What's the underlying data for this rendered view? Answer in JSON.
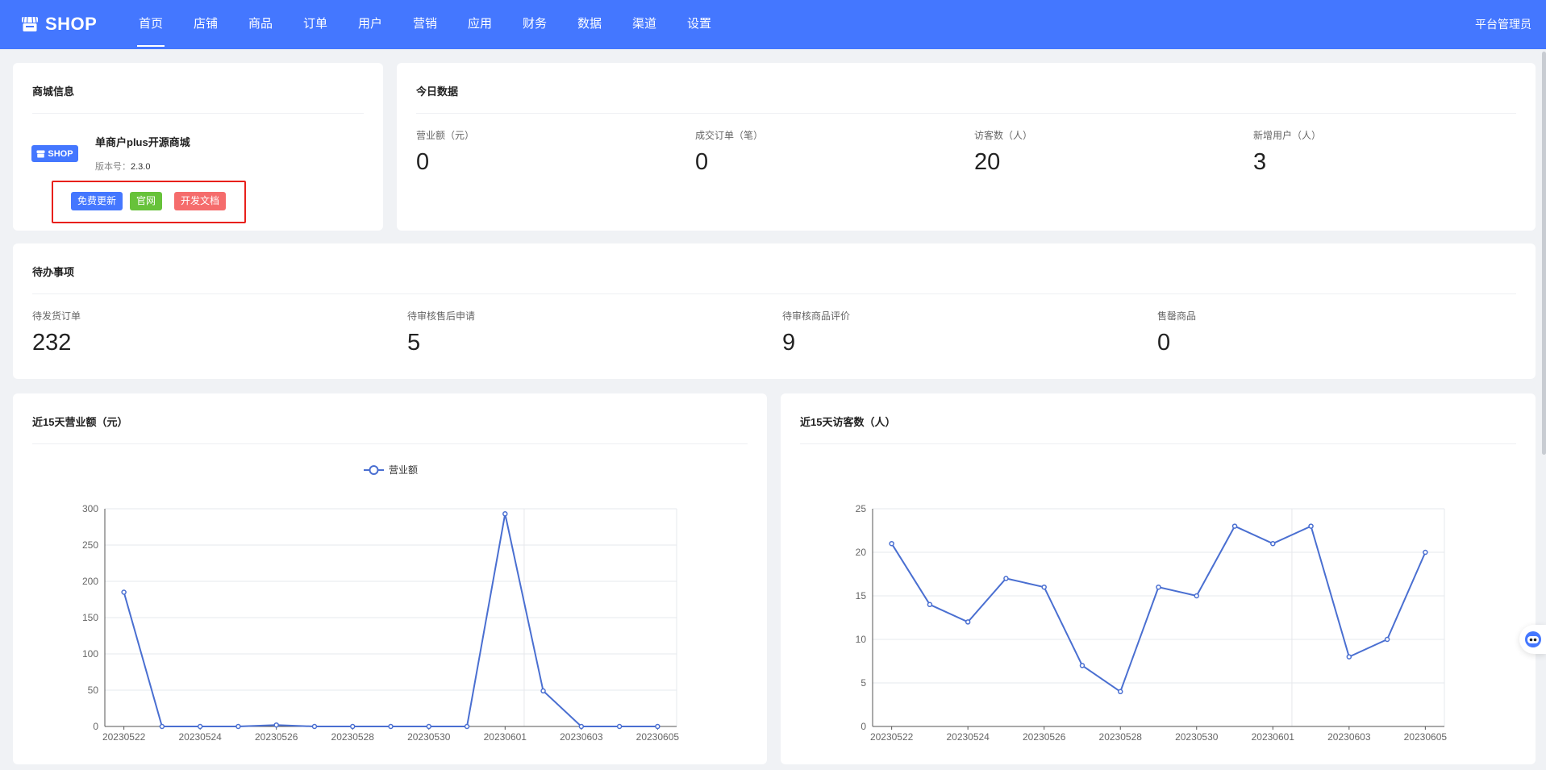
{
  "header": {
    "logo_text": "SHOP",
    "logo_icon": "store-icon",
    "nav": [
      {
        "label": "首页",
        "active": true
      },
      {
        "label": "店铺"
      },
      {
        "label": "商品"
      },
      {
        "label": "订单"
      },
      {
        "label": "用户"
      },
      {
        "label": "营销"
      },
      {
        "label": "应用"
      },
      {
        "label": "财务"
      },
      {
        "label": "数据"
      },
      {
        "label": "渠道"
      },
      {
        "label": "设置"
      }
    ],
    "user_role": "平台管理员"
  },
  "shop_info": {
    "title": "商城信息",
    "badge_text": "SHOP",
    "name": "单商户plus开源商城",
    "version_label": "版本号：",
    "version": "2.3.0",
    "buttons": {
      "update": "免费更新",
      "website": "官网",
      "docs": "开发文档"
    }
  },
  "today": {
    "title": "今日数据",
    "stats": [
      {
        "label": "营业额（元）",
        "value": "0"
      },
      {
        "label": "成交订单（笔）",
        "value": "0"
      },
      {
        "label": "访客数（人）",
        "value": "20"
      },
      {
        "label": "新增用户（人）",
        "value": "3"
      }
    ]
  },
  "todo": {
    "title": "待办事项",
    "items": [
      {
        "label": "待发货订单",
        "value": "232"
      },
      {
        "label": "待审核售后申请",
        "value": "5"
      },
      {
        "label": "待审核商品评价",
        "value": "9"
      },
      {
        "label": "售罄商品",
        "value": "0"
      }
    ]
  },
  "chart_data": [
    {
      "type": "line",
      "title": "近15天营业额（元）",
      "legend": "营业额",
      "legend_position": "top-center",
      "x": [
        "20230522",
        "20230523",
        "20230524",
        "20230525",
        "20230526",
        "20230527",
        "20230528",
        "20230529",
        "20230530",
        "20230531",
        "20230601",
        "20230602",
        "20230603",
        "20230604",
        "20230605"
      ],
      "x_tick_labels": [
        "20230522",
        "20230524",
        "20230526",
        "20230528",
        "20230530",
        "20230601",
        "20230603",
        "20230605"
      ],
      "series": [
        {
          "name": "营业额",
          "values": [
            185,
            0,
            0,
            0,
            2,
            0,
            0,
            0,
            0,
            0,
            293,
            49,
            0,
            0,
            0
          ]
        }
      ],
      "ylim": [
        0,
        300
      ],
      "y_ticks": [
        0,
        50,
        100,
        150,
        200,
        250,
        300
      ],
      "grid": true,
      "color": "#4a6fd1"
    },
    {
      "type": "line",
      "title": "近15天访客数（人）",
      "x": [
        "20230522",
        "20230523",
        "20230524",
        "20230525",
        "20230526",
        "20230527",
        "20230528",
        "20230529",
        "20230530",
        "20230531",
        "20230601",
        "20230602",
        "20230603",
        "20230604",
        "20230605"
      ],
      "x_tick_labels": [
        "20230522",
        "20230524",
        "20230526",
        "20230528",
        "20230530",
        "20230601",
        "20230603",
        "20230605"
      ],
      "series": [
        {
          "values": [
            21,
            14,
            12,
            17,
            16,
            7,
            4,
            16,
            15,
            23,
            21,
            23,
            8,
            10,
            20
          ]
        }
      ],
      "ylim": [
        0,
        25
      ],
      "y_ticks": [
        0,
        5,
        10,
        15,
        20,
        25
      ],
      "grid": true,
      "color": "#4a6fd1"
    }
  ]
}
